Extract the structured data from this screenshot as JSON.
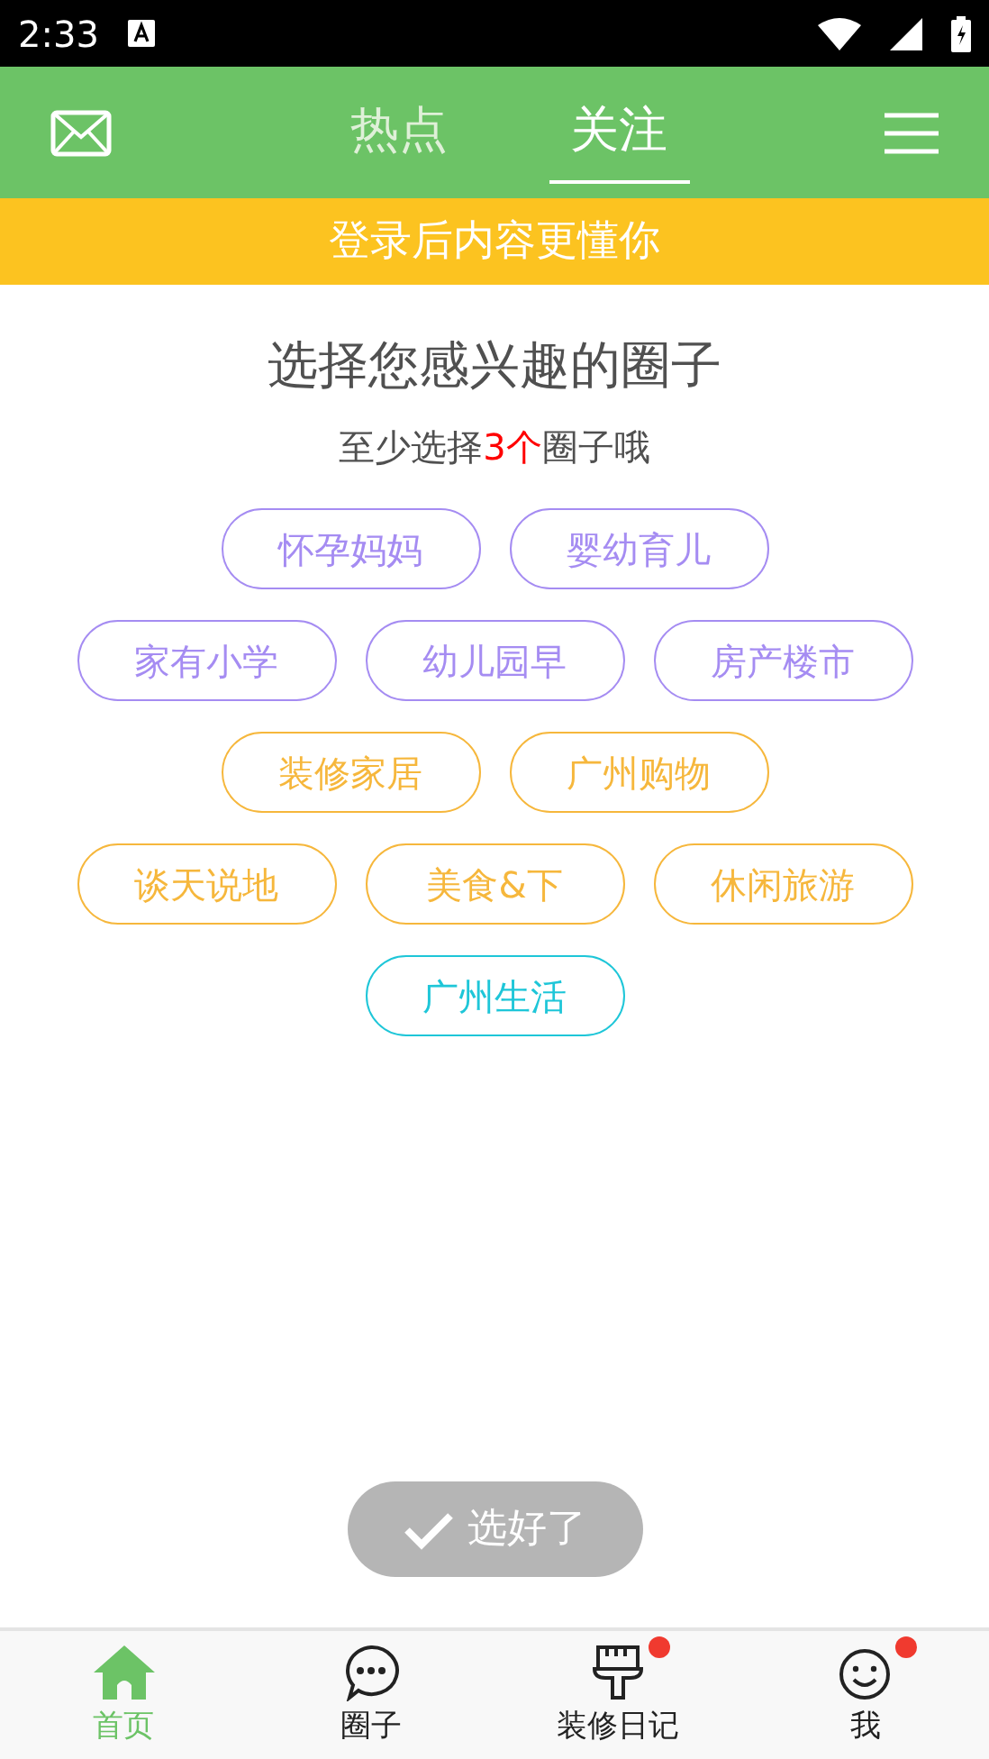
{
  "status_bar": {
    "time": "2:33"
  },
  "header": {
    "tabs": [
      {
        "label": "热点",
        "selected": false
      },
      {
        "label": "关注",
        "selected": true
      }
    ]
  },
  "login_banner": "登录后内容更懂你",
  "heading": "选择您感兴趣的圈子",
  "subtitle": {
    "before": "至少选择",
    "highlight": "3个",
    "after": "圈子哦"
  },
  "tag_rows": [
    [
      {
        "label": "怀孕妈妈",
        "color": "#a58cf2",
        "selected": false
      },
      {
        "label": "婴幼育儿",
        "color": "#a58cf2",
        "selected": false
      }
    ],
    [
      {
        "label": "家有小学",
        "color": "#a58cf2",
        "selected": false
      },
      {
        "label": "幼儿园早",
        "color": "#a58cf2",
        "selected": false
      },
      {
        "label": "房产楼市",
        "color": "#a58cf2",
        "selected": false
      }
    ],
    [
      {
        "label": "装修家居",
        "color": "#f6b73c",
        "selected": false
      },
      {
        "label": "广州购物",
        "color": "#f6b73c",
        "selected": false
      }
    ],
    [
      {
        "label": "谈天说地",
        "color": "#f6b73c",
        "selected": false
      },
      {
        "label": "美食&下",
        "color": "#f6b73c",
        "selected": false
      },
      {
        "label": "休闲旅游",
        "color": "#f6b73c",
        "selected": false
      }
    ],
    [
      {
        "label": "广州生活",
        "color": "#1ec6d8",
        "selected": false
      }
    ]
  ],
  "done_button": {
    "label": "选好了",
    "disabled": true
  },
  "bottom_nav": [
    {
      "kind": "home",
      "label": "首页",
      "selected": true,
      "badge": false
    },
    {
      "kind": "chat",
      "label": "圈子",
      "selected": false,
      "badge": false
    },
    {
      "kind": "brush",
      "label": "装修日记",
      "selected": false,
      "badge": true
    },
    {
      "kind": "smile",
      "label": "我",
      "selected": false,
      "badge": true
    }
  ]
}
